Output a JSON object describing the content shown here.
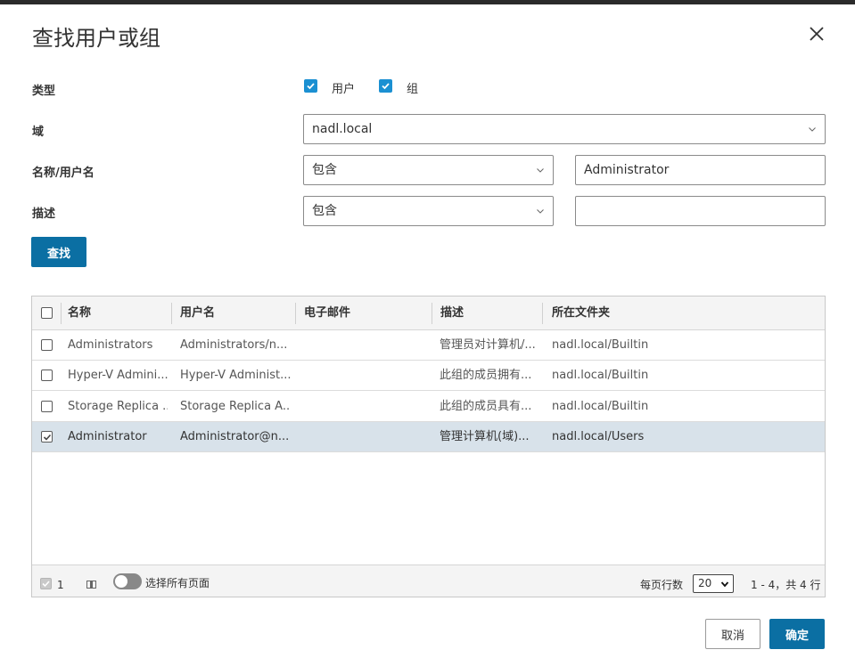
{
  "dialog": {
    "title": "查找用户或组"
  },
  "form": {
    "type_label": "类型",
    "type_options": [
      {
        "label": "用户",
        "checked": true
      },
      {
        "label": "组",
        "checked": true
      }
    ],
    "domain_label": "域",
    "domain_value": "nadl.local",
    "name_label": "名称/用户名",
    "name_operator": "包含",
    "name_value": "Administrator",
    "desc_label": "描述",
    "desc_operator": "包含",
    "desc_value": "",
    "find_button": "查找"
  },
  "table": {
    "columns": [
      "名称",
      "用户名",
      "电子邮件",
      "描述",
      "所在文件夹"
    ],
    "rows": [
      {
        "name": "Administrators",
        "username": "Administrators/n...",
        "email": "",
        "description": "管理员对计算机/...",
        "folder": "nadl.local/Builtin",
        "checked": false
      },
      {
        "name": "Hyper-V Admini...",
        "username": "Hyper-V Administ...",
        "email": "",
        "description": "此组的成员拥有...",
        "folder": "nadl.local/Builtin",
        "checked": false
      },
      {
        "name": "Storage Replica ...",
        "username": "Storage Replica A...",
        "email": "",
        "description": "此组的成员具有...",
        "folder": "nadl.local/Builtin",
        "checked": false
      },
      {
        "name": "Administrator",
        "username": "Administrator@n...",
        "email": "",
        "description": "管理计算机(域)...",
        "folder": "nadl.local/Users",
        "checked": true
      }
    ]
  },
  "footer": {
    "selected_count": "1",
    "select_all_pages": "选择所有页面",
    "rows_per_page_label": "每页行数",
    "rows_per_page": "20",
    "range": "1 - 4，共 4 行"
  },
  "actions": {
    "cancel": "取消",
    "ok": "确定"
  },
  "colors": {
    "primary": "#0b6fa3",
    "checkbox_blue": "#1b90d2",
    "selected_row": "#d8e2ea"
  }
}
